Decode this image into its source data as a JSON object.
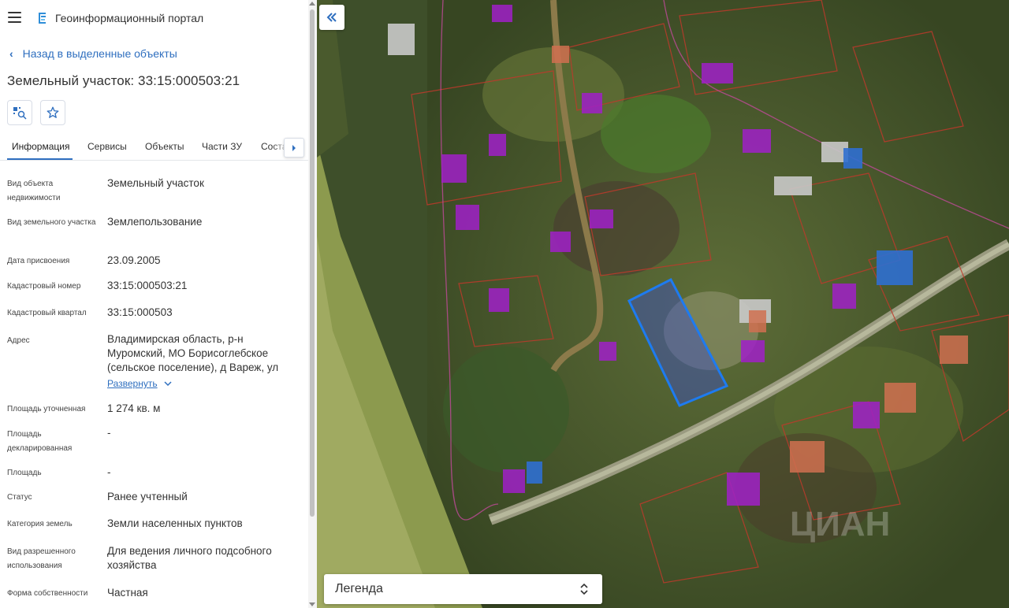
{
  "header": {
    "app_title": "Геоинформационный портал"
  },
  "nav": {
    "back_label": "Назад в выделенные объекты"
  },
  "object": {
    "title": "Земельный участок: 33:15:000503:21"
  },
  "tabs": [
    {
      "label": "Информация"
    },
    {
      "label": "Сервисы"
    },
    {
      "label": "Объекты"
    },
    {
      "label": "Части ЗУ"
    },
    {
      "label": "Соста"
    }
  ],
  "properties": [
    {
      "label": "Вид объекта недвижимости",
      "value": "Земельный участок"
    },
    {
      "label": "Вид земельного участка",
      "value": "Землепользование"
    },
    {
      "label": "Дата присвоения",
      "value": "23.09.2005"
    },
    {
      "label": "Кадастровый номер",
      "value": "33:15:000503:21"
    },
    {
      "label": "Кадастровый квартал",
      "value": "33:15:000503"
    },
    {
      "label": "Адрес",
      "value": "Владимирская область, р-н Муромский, МО Борисоглебское (сельское поселение), д Вареж, ул"
    },
    {
      "label": "Площадь уточненная",
      "value": "1 274 кв. м"
    },
    {
      "label": "Площадь декларированная",
      "value": "-"
    },
    {
      "label": "Площадь",
      "value": "-"
    },
    {
      "label": "Статус",
      "value": "Ранее учтенный"
    },
    {
      "label": "Категория земель",
      "value": "Земли населенных пунктов"
    },
    {
      "label": "Вид разрешенного использования",
      "value": "Для ведения личного подсобного хозяйства"
    },
    {
      "label": "Форма собственности",
      "value": "Частная"
    }
  ],
  "address_expand_label": "Развернуть",
  "map": {
    "legend_label": "Легенда",
    "selected_parcel_color": "#1e7bf0",
    "boundary_color": "#c0392b",
    "building_highlight_color": "#a020c8"
  },
  "icons": {
    "menu": "hamburger-icon",
    "logo": "portal-logo-icon",
    "back": "chevron-left-icon",
    "find_on_map": "map-locate-icon",
    "favorite": "star-icon",
    "tabs_next": "chevron-right-icon",
    "expand": "chevron-down-icon",
    "collapse_panel": "double-chevron-left-icon",
    "legend_toggle": "up-down-chevron-icon"
  }
}
